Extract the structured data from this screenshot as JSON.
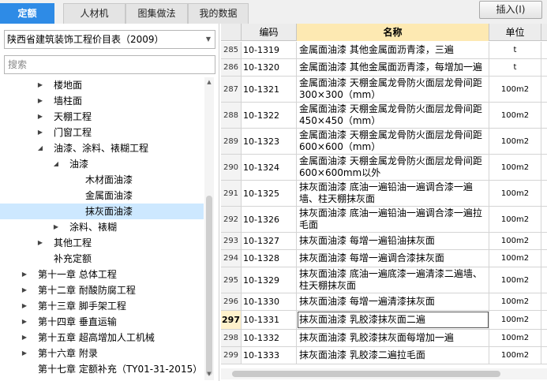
{
  "tabs": [
    {
      "label": "定额",
      "active": true
    },
    {
      "label": "人材机",
      "active": false
    },
    {
      "label": "图集做法",
      "active": false
    },
    {
      "label": "我的数据",
      "active": false
    }
  ],
  "insert_button": "插入(I)",
  "library_select": "陕西省建筑装饰工程价目表（2009）",
  "search_placeholder": "搜索",
  "tree": [
    {
      "label": "楼地面",
      "toggle": "▶"
    },
    {
      "label": "墙柱面",
      "toggle": "▶"
    },
    {
      "label": "天棚工程",
      "toggle": "▶"
    },
    {
      "label": "门窗工程",
      "toggle": "▶"
    },
    {
      "label": "油漆、涂料、裱糊工程",
      "toggle": "◢"
    },
    {
      "label": "油漆",
      "toggle": "◢"
    },
    {
      "label": "木材面油漆",
      "toggle": ""
    },
    {
      "label": "金属面油漆",
      "toggle": ""
    },
    {
      "label": "抹灰面油漆",
      "toggle": "",
      "selected": true
    },
    {
      "label": "涂料、裱糊",
      "toggle": "▶"
    },
    {
      "label": "其他工程",
      "toggle": "▶"
    },
    {
      "label": "补充定额",
      "toggle": ""
    },
    {
      "label": "第十一章 总体工程",
      "toggle": "▶"
    },
    {
      "label": "第十二章 耐酸防腐工程",
      "toggle": "▶"
    },
    {
      "label": "第十三章 脚手架工程",
      "toggle": "▶"
    },
    {
      "label": "第十四章 垂直运输",
      "toggle": "▶"
    },
    {
      "label": "第十五章 超高增加人工机械",
      "toggle": "▶"
    },
    {
      "label": "第十六章 附录",
      "toggle": "▶"
    },
    {
      "label": "第十七章 定额补充（TY01-31-2015）",
      "toggle": ""
    }
  ],
  "grid": {
    "columns": {
      "code": "编码",
      "name": "名称",
      "unit": "单位"
    },
    "rows": [
      {
        "num": "285",
        "code": "10-1319",
        "name": "金属面油漆 其他金属面沥青漆，三遍",
        "unit": "t"
      },
      {
        "num": "286",
        "code": "10-1320",
        "name": "金属面油漆 其他金属面沥青漆，每增加一遍",
        "unit": "t"
      },
      {
        "num": "287",
        "code": "10-1321",
        "name": "金属面油漆 天棚金属龙骨防火面层龙骨间距300×300（mm）",
        "unit": "100m2"
      },
      {
        "num": "288",
        "code": "10-1322",
        "name": "金属面油漆 天棚金属龙骨防火面层龙骨间距450×450（mm）",
        "unit": "100m2"
      },
      {
        "num": "289",
        "code": "10-1323",
        "name": "金属面油漆 天棚金属龙骨防火面层龙骨间距600×600（mm）",
        "unit": "100m2"
      },
      {
        "num": "290",
        "code": "10-1324",
        "name": "金属面油漆 天棚金属龙骨防火面层龙骨间距600×600mm以外",
        "unit": "100m2"
      },
      {
        "num": "291",
        "code": "10-1325",
        "name": "抹灰面油漆 底油一遍铅油一遍调合漆一遍墙、柱天棚抹灰面",
        "unit": "100m2"
      },
      {
        "num": "292",
        "code": "10-1326",
        "name": "抹灰面油漆 底油一遍铅油一遍调合漆一遍拉毛面",
        "unit": "100m2"
      },
      {
        "num": "293",
        "code": "10-1327",
        "name": "抹灰面油漆 每增一遍铅油抹灰面",
        "unit": "100m2"
      },
      {
        "num": "294",
        "code": "10-1328",
        "name": "抹灰面油漆 每增一遍调合漆抹灰面",
        "unit": "100m2"
      },
      {
        "num": "295",
        "code": "10-1329",
        "name": "抹灰面油漆 底油一遍底漆一遍清漆二遍墙、柱天棚抹灰面",
        "unit": "100m2"
      },
      {
        "num": "296",
        "code": "10-1330",
        "name": "抹灰面油漆 每增一遍清漆抹灰面",
        "unit": "100m2"
      },
      {
        "num": "297",
        "code": "10-1331",
        "name": "抹灰面油漆 乳胶漆抹灰面二遍",
        "unit": "100m2",
        "current": true
      },
      {
        "num": "298",
        "code": "10-1332",
        "name": "抹灰面油漆 乳胶漆抹灰面每增加一遍",
        "unit": "100m2"
      },
      {
        "num": "299",
        "code": "10-1333",
        "name": "抹灰面油漆 乳胶漆二遍拉毛面",
        "unit": "100m2"
      }
    ]
  }
}
